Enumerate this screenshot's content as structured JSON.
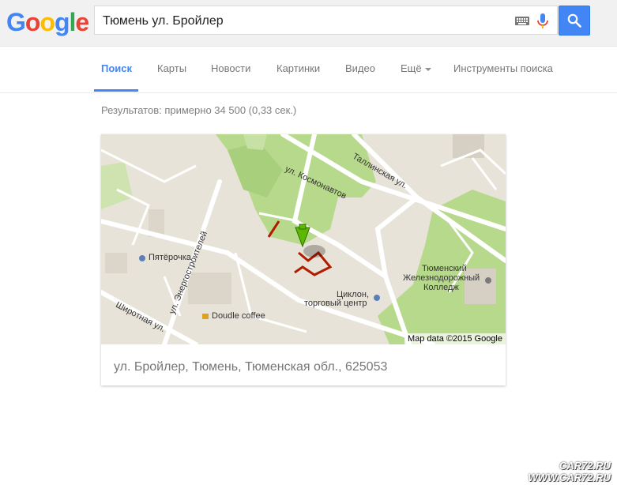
{
  "logo": {
    "text": "Google",
    "letters": [
      "G",
      "o",
      "o",
      "g",
      "l",
      "e"
    ]
  },
  "search": {
    "query": "Тюмень ул. Бройлер",
    "icons": [
      "keyboard-icon",
      "mic-icon",
      "search-icon"
    ]
  },
  "tabs": [
    {
      "label": "Поиск",
      "active": true
    },
    {
      "label": "Карты"
    },
    {
      "label": "Новости"
    },
    {
      "label": "Картинки"
    },
    {
      "label": "Видео"
    },
    {
      "label": "Ещё"
    },
    {
      "label": "Инструменты поиска"
    }
  ],
  "result_stats": "Результатов: примерно 34 500 (0,33 сек.)",
  "map": {
    "labels": {
      "kosmonavtov": "ул. Космонавтов",
      "tallinskaya": "Таллинская ул.",
      "energostroiteley": "ул. Энергостроителей",
      "shirotnaya": "Широтная ул.",
      "pyaterochka": "Пятёрочка",
      "tsiklon_1": "Циклон,",
      "tsiklon_2": "торговый центр",
      "doudle": "Doudle coffee",
      "college_1": "Тюменский",
      "college_2": "Железнодорожный",
      "college_3": "Колледж"
    },
    "attribution": "Map data ©2015 Google"
  },
  "address": "ул. Бройлер, Тюмень, Тюменская обл., 625053",
  "watermark": {
    "line1": "CAR72.RU",
    "line2": "WWW.CAR72.RU"
  },
  "colors": {
    "accent": "#4285f4",
    "marker": "#5cb800",
    "route": "#b31b00",
    "park": "#b7d98c"
  }
}
